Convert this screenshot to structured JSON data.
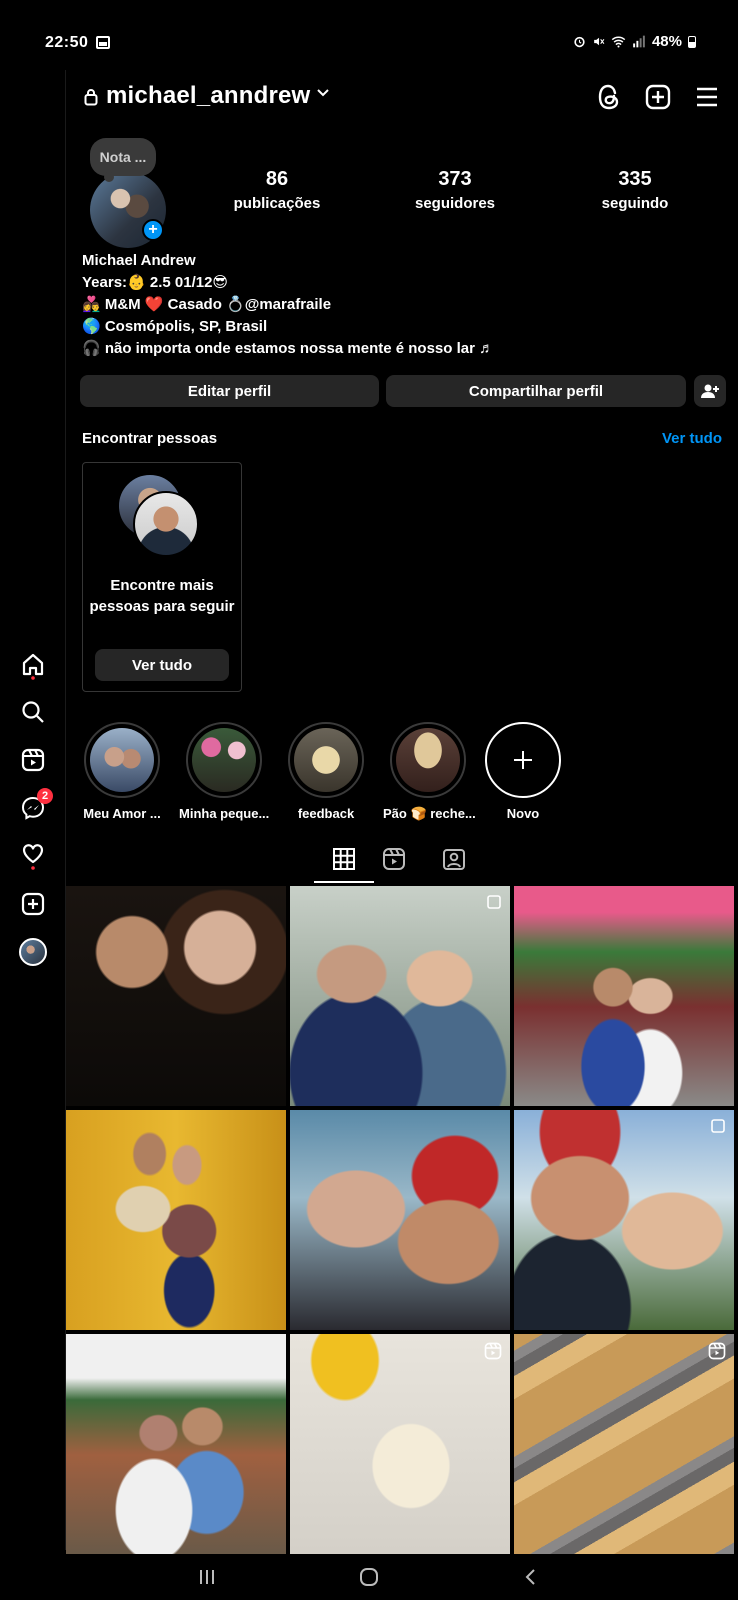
{
  "status_bar": {
    "time": "22:50",
    "battery": "48%",
    "icons": [
      "gallery-icon",
      "alarm-icon",
      "mute-icon",
      "wifi-icon",
      "signal-icon",
      "battery-icon"
    ]
  },
  "header": {
    "username": "michael_anndrew",
    "icons": [
      "lock-icon",
      "chevron-down-icon",
      "threads-icon",
      "create-plus-icon",
      "menu-icon"
    ]
  },
  "note": {
    "label": "Nota ..."
  },
  "stats": [
    {
      "value": "86",
      "label": "publicações"
    },
    {
      "value": "373",
      "label": "seguidores"
    },
    {
      "value": "335",
      "label": "seguindo"
    }
  ],
  "bio": {
    "name": "Michael Andrew",
    "lines": [
      "Years:👶 2.5   01/12😎",
      "👩‍❤️‍👨 M&M ❤️ Casado 💍@marafraile",
      "🌎 Cosmópolis, SP, Brasil",
      "🎧 não importa onde estamos nossa mente é nosso lar ♬"
    ]
  },
  "actions": {
    "edit": "Editar perfil",
    "share": "Compartilhar perfil"
  },
  "find_people": {
    "title": "Encontrar pessoas",
    "see_all": "Ver tudo",
    "card_text": "Encontre mais pessoas para seguir",
    "card_button": "Ver tudo"
  },
  "highlights": [
    {
      "label": "Meu Amor ..."
    },
    {
      "label": "Minha peque..."
    },
    {
      "label": "feedback"
    },
    {
      "label": "Pão 🍞 reche..."
    },
    {
      "label": "Novo"
    }
  ],
  "sidebar": {
    "items": [
      "home-icon",
      "search-icon",
      "reels-icon",
      "messenger-icon",
      "heart-icon",
      "create-icon",
      "profile-avatar"
    ],
    "messenger_badge": "2"
  },
  "colors": {
    "accent": "#0095f6",
    "badge": "#ff3040",
    "button_bg": "#262626",
    "background": "#000000"
  }
}
